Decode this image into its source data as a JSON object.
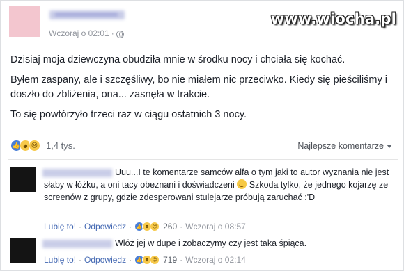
{
  "post": {
    "timestamp": "Wczoraj o 02:01",
    "separator": "·",
    "watermark": "www.wiocha.pl",
    "paragraphs": [
      "Dzisiaj moja dziewczyna obudziła mnie w środku nocy i chciała się kochać.",
      "Byłem zaspany, ale i szczęśliwy, bo nie miałem nic przeciwko. Kiedy się pieściliśmy i doszło do zbliżenia, ona... zasnęła w trakcie.",
      "To się powtórzyło trzeci raz w ciągu ostatnich 3 nocy."
    ],
    "reaction_count": "1,4 tys.",
    "reaction_icons": [
      "like-icon",
      "haha-icon",
      "sad-icon"
    ],
    "sort_label": "Najlepsze komentarze"
  },
  "comments": [
    {
      "text_a": "Uuu...I te komentarze samców alfa o tym jaki to autor wyznania nie jest słaby w łóżku, a oni tacy obeznani i doświadczeni",
      "text_b": "Szkoda tylko, że jednego kojarzę ze screenów z grupy, gdzie zdesperowani stulejarze próbują zaruchać :'D",
      "like_label": "Lubię to!",
      "reply_label": "Odpowiedz",
      "reaction_count": "260",
      "timestamp": "Wczoraj o 08:57"
    },
    {
      "text_a": "Wlóż jej w dupe i zobaczymy czy jest taka śpiąca.",
      "text_b": "",
      "like_label": "Lubię to!",
      "reply_label": "Odpowiedz",
      "reaction_count": "719",
      "timestamp": "Wczoraj o 02:14"
    }
  ],
  "colors": {
    "link": "#4267b2",
    "meta": "#90949c",
    "like": "#4a7fd6",
    "emoji": "#f7c94a"
  }
}
